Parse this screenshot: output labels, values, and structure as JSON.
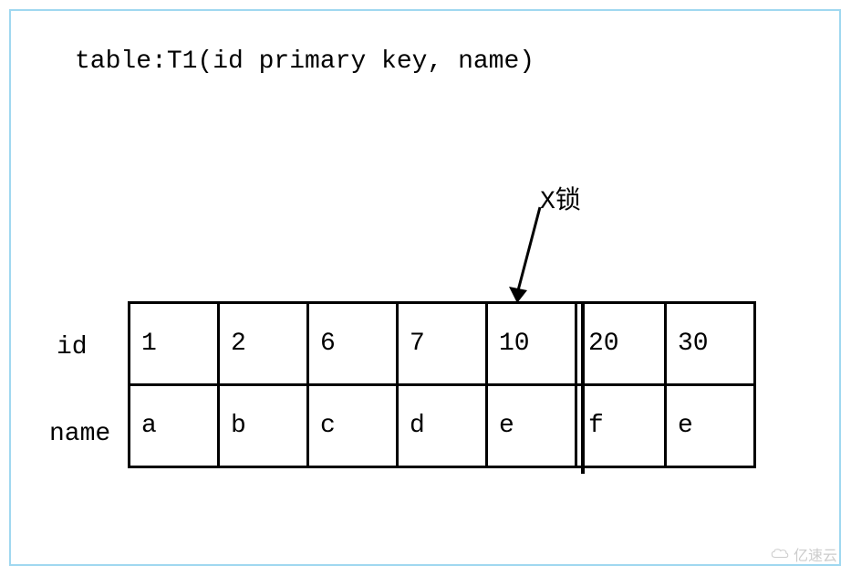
{
  "title": "table:T1(id primary key, name)",
  "lock_label": "X锁",
  "row_labels": {
    "id": "id",
    "name": "name"
  },
  "chart_data": {
    "type": "table",
    "title": "table:T1(id primary key, name)",
    "columns": [
      "1",
      "2",
      "6",
      "7",
      "10",
      "20",
      "30"
    ],
    "rows": [
      {
        "label": "id",
        "values": [
          "1",
          "2",
          "6",
          "7",
          "10",
          "20",
          "30"
        ]
      },
      {
        "label": "name",
        "values": [
          "a",
          "b",
          "c",
          "d",
          "e",
          "f",
          "e"
        ]
      }
    ],
    "annotations": [
      {
        "text": "X锁",
        "target_column_index": 4,
        "target_value": "10",
        "type": "arrow-label"
      }
    ]
  },
  "watermark": "亿速云"
}
